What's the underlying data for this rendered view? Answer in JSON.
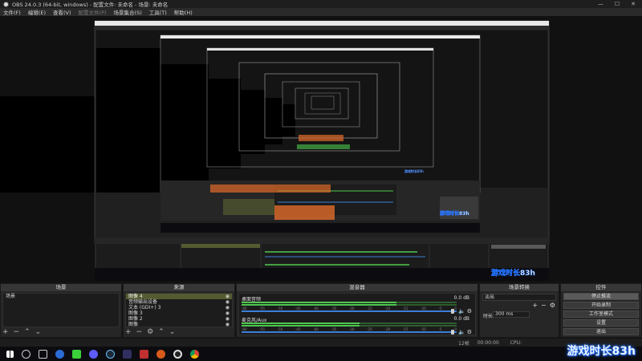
{
  "window": {
    "title": "OBS 24.0.3 (64-bit, windows) - 配置文件: 未命名 - 场景: 未命名",
    "minimize": "—",
    "maximize": "☐",
    "close": "✕"
  },
  "menu": [
    "文件(F)",
    "编辑(E)",
    "查看(V)",
    "配置文件(P)",
    "场景集合(S)",
    "工具(T)",
    "帮助(H)"
  ],
  "docks": {
    "scenes": {
      "title": "场景",
      "items": [
        "场景"
      ]
    },
    "sources": {
      "title": "来源",
      "items": [
        "图像 4",
        "音频输出设备",
        "文本 (GDI+) 3",
        "图像 3",
        "图像 2",
        "图像"
      ]
    },
    "mixer": {
      "title": "混音器",
      "tracks": [
        {
          "name": "桌面音频",
          "db": "0.0 dB",
          "level": 0.72,
          "volume": 0.98
        },
        {
          "name": "麦克风/Aux",
          "db": "0.0 dB",
          "level": 0.55,
          "volume": 0.98
        }
      ],
      "ticks": [
        "-60",
        "-55",
        "-50",
        "-45",
        "-40",
        "-35",
        "-30",
        "-25",
        "-20",
        "-15",
        "-10",
        "-5",
        "0"
      ]
    },
    "transitions": {
      "title": "场景转换",
      "type": "淡出",
      "duration_label": "时长",
      "duration_value": "300 ms"
    },
    "controls": {
      "title": "控件",
      "buttons": [
        "停止推流",
        "开始录制",
        "工作室模式",
        "设置",
        "退出"
      ]
    }
  },
  "status": {
    "dropped": "12帧",
    "time": "00:00:00",
    "cpu_label": "CPU:",
    "fps": "30.00 fps"
  },
  "watermark": "游戏时长83h",
  "footer_icons": {
    "add": "+",
    "remove": "−",
    "settings": "⚙",
    "up": "⌃",
    "down": "⌄"
  },
  "colors": {
    "meter": "#4ec84e",
    "volume": "#3b7ed8",
    "selected": "#545b30",
    "accent_orange": "#e06b2a"
  }
}
